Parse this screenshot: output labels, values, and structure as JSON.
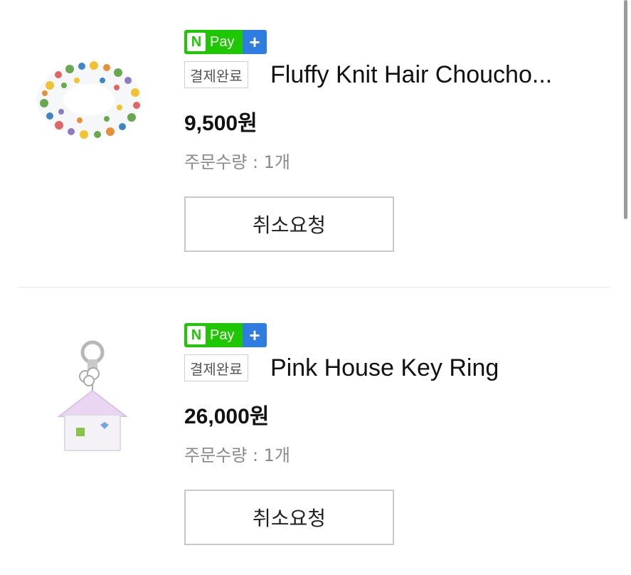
{
  "orders": [
    {
      "npay_n": "N",
      "npay_label": "Pay",
      "npay_plus": "+",
      "status": "결제완료",
      "product_name": "Fluffy Knit Hair Choucho...",
      "price": "9,500원",
      "quantity": "주문수량 : 1개",
      "cancel_label": "취소요청",
      "image_icon": "beaded-scrunchie-image"
    },
    {
      "npay_n": "N",
      "npay_label": "Pay",
      "npay_plus": "+",
      "status": "결제완료",
      "product_name": "Pink House Key Ring",
      "price": "26,000원",
      "quantity": "주문수량 : 1개",
      "cancel_label": "취소요청",
      "image_icon": "house-keyring-image"
    }
  ],
  "colors": {
    "npay_green": "#1ec800",
    "npay_blue": "#2f7de1",
    "border": "#c8c8c8",
    "muted_text": "#8a8a8a"
  }
}
